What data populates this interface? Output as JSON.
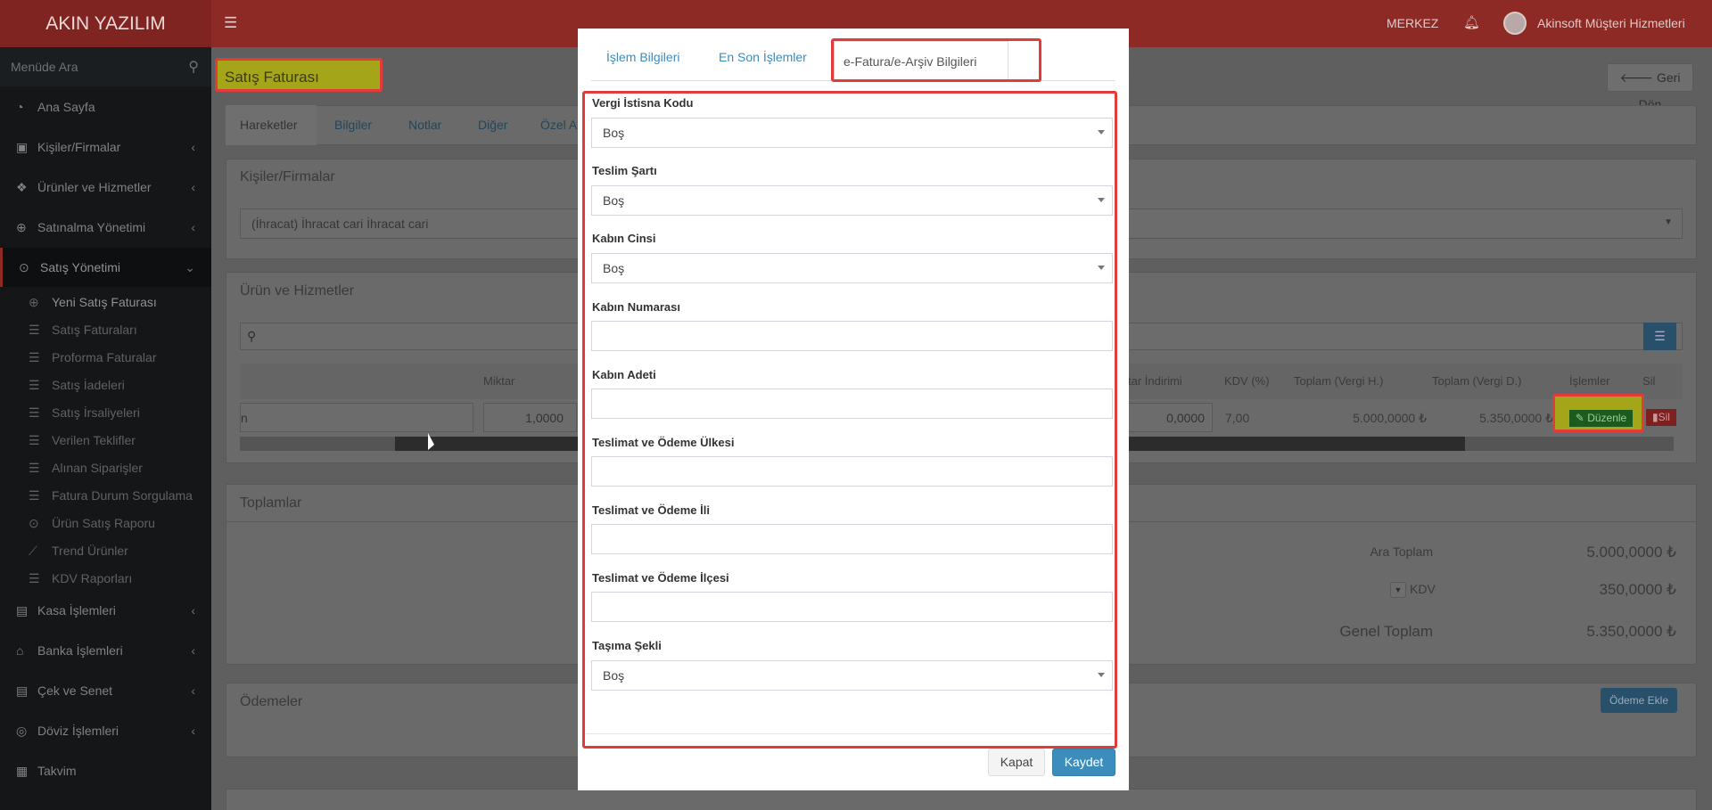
{
  "app": {
    "brand": "AKIN YAZILIM",
    "branch": "MERKEZ",
    "user": "Akinsoft Müşteri Hizmetleri"
  },
  "sidebar": {
    "search_placeholder": "Menüde Ara",
    "items": [
      {
        "label": "Ana Sayfa",
        "icon": "dashboard-icon"
      },
      {
        "label": "Kişiler/Firmalar",
        "icon": "address-book-icon"
      },
      {
        "label": "Ürünler ve Hizmetler",
        "icon": "cubes-icon"
      },
      {
        "label": "Satınalma Yönetimi",
        "icon": "plus-circle-icon"
      },
      {
        "label": "Satış Yönetimi",
        "icon": "arrow-circle-icon"
      }
    ],
    "sub_items": [
      "Yeni Satış Faturası",
      "Satış Faturaları",
      "Proforma Faturalar",
      "Satış İadeleri",
      "Satış İrsaliyeleri",
      "Verilen Teklifler",
      "Alınan Siparişler",
      "Fatura Durum Sorgulama",
      "Ürün Satış Raporu",
      "Trend Ürünler",
      "KDV Raporları"
    ],
    "bottom_items": [
      {
        "label": "Kasa İşlemleri",
        "icon": "money-icon"
      },
      {
        "label": "Banka İşlemleri",
        "icon": "bank-icon"
      },
      {
        "label": "Çek ve Senet",
        "icon": "check-icon"
      },
      {
        "label": "Döviz İşlemleri",
        "icon": "currency-icon"
      },
      {
        "label": "Takvim",
        "icon": "calendar-icon"
      }
    ]
  },
  "page": {
    "title": "Satış Faturası",
    "back_button": "Geri Dön",
    "tabs": [
      "Hareketler",
      "Bilgiler",
      "Notlar",
      "Diğer",
      "Özel A"
    ],
    "contacts_title": "Kişiler/Firmalar",
    "contact_value": "(İhracat) İhracat cari İhracat cari",
    "products_title": "Ürün ve Hizmetler",
    "table_headers": [
      "Miktar",
      "tar İndirimi",
      "KDV (%)",
      "Toplam (Vergi H.)",
      "Toplam (Vergi D.)",
      "İşlemler",
      "Sil"
    ],
    "row": {
      "name_tail": "n",
      "miktar": "1,0000",
      "discount": "0,0000",
      "kdv": "7,00",
      "total_h": "5.000,0000 ₺",
      "total_d": "5.350,0000 ₺",
      "edit": "Düzenle",
      "delete": "Sil"
    },
    "totals_title": "Toplamlar",
    "totals": {
      "ara_label": "Ara Toplam",
      "ara_value": "5.000,0000 ₺",
      "kdv_label": "KDV",
      "kdv_value": "350,0000 ₺",
      "genel_label": "Genel Toplam",
      "genel_value": "5.350,0000 ₺"
    },
    "payments_title": "Ödemeler",
    "add_payment": "Ödeme Ekle"
  },
  "modal": {
    "tabs": [
      "İşlem Bilgileri",
      "En Son İşlemler",
      "e-Fatura/e-Arşiv Bilgileri"
    ],
    "fields": [
      {
        "label": "Vergi İstisna Kodu",
        "type": "select",
        "value": "Boş"
      },
      {
        "label": "Teslim Şartı",
        "type": "select",
        "value": "Boş"
      },
      {
        "label": "Kabın Cinsi",
        "type": "select",
        "value": "Boş"
      },
      {
        "label": "Kabın Numarası",
        "type": "input",
        "value": ""
      },
      {
        "label": "Kabın Adeti",
        "type": "input",
        "value": ""
      },
      {
        "label": "Teslimat ve Ödeme Ülkesi",
        "type": "input",
        "value": ""
      },
      {
        "label": "Teslimat ve Ödeme İli",
        "type": "input",
        "value": ""
      },
      {
        "label": "Teslimat ve Ödeme İlçesi",
        "type": "input",
        "value": ""
      },
      {
        "label": "Taşıma Şekli",
        "type": "select",
        "value": "Boş"
      }
    ],
    "close_label": "Kapat",
    "save_label": "Kaydet"
  },
  "colors": {
    "topbar": "#8e2a26",
    "highlight": "#e33a3a",
    "primary": "#3c8dbc"
  }
}
